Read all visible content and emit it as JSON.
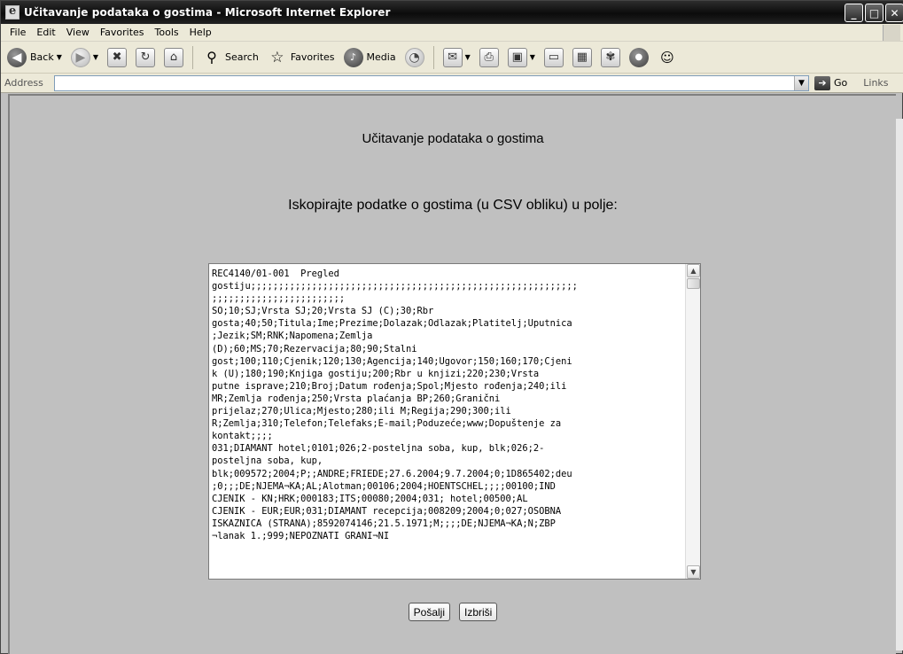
{
  "window": {
    "title": "Učitavanje podataka o gostima - Microsoft Internet Explorer",
    "minimize": "_",
    "maximize": "□",
    "close": "✕"
  },
  "menu": {
    "items": [
      {
        "label": "File"
      },
      {
        "label": "Edit"
      },
      {
        "label": "View"
      },
      {
        "label": "Favorites"
      },
      {
        "label": "Tools"
      },
      {
        "label": "Help"
      }
    ]
  },
  "toolbar": {
    "back_label": "Back",
    "search_label": "Search",
    "favorites_label": "Favorites",
    "media_label": "Media"
  },
  "address": {
    "label": "Address",
    "value": "",
    "go_label": "Go",
    "links_label": "Links"
  },
  "page": {
    "title": "Učitavanje podataka o gostima",
    "instruction": "Iskopirajte podatke o gostima (u CSV obliku) u polje:",
    "csv_text": "REC4140/01-001  Pregled\ngostiju;;;;;;;;;;;;;;;;;;;;;;;;;;;;;;;;;;;;;;;;;;;;;;;;;;;;;;;;;;;\n;;;;;;;;;;;;;;;;;;;;;;;;\nSO;10;SJ;Vrsta SJ;20;Vrsta SJ (C);30;Rbr\ngosta;40;50;Titula;Ime;Prezime;Dolazak;Odlazak;Platitelj;Uputnica\n;Jezik;SM;RNK;Napomena;Zemlja\n(D);60;MS;70;Rezervacija;80;90;Stalni\ngost;100;110;Cjenik;120;130;Agencija;140;Ugovor;150;160;170;Cjeni\nk (U);180;190;Knjiga gostiju;200;Rbr u knjizi;220;230;Vrsta\nputne isprave;210;Broj;Datum rođenja;Spol;Mjesto rođenja;240;ili\nMR;Zemlja rođenja;250;Vrsta plaćanja BP;260;Granični\nprijelaz;270;Ulica;Mjesto;280;ili M;Regija;290;300;ili\nR;Zemlja;310;Telefon;Telefaks;E-mail;Poduzeće;www;Dopuštenje za\nkontakt;;;;\n031;DIAMANT hotel;0101;026;2-posteljna soba, kup, blk;026;2-\nposteljna soba, kup,\nblk;009572;2004;P;;ANDRE;FRIEDE;27.6.2004;9.7.2004;0;1D865402;deu\n;0;;;DE;NJEMA¬KA;AL;Alotman;00106;2004;HOENTSCHEL;;;;00100;IND\nCJENIK - KN;HRK;000183;ITS;00080;2004;031; hotel;00500;AL\nCJENIK - EUR;EUR;031;DIAMANT recepcija;008209;2004;0;027;OSOBNA\nISKAZNICA (STRANA);8592074146;21.5.1971;M;;;;DE;NJEMA¬KA;N;ZBP\n¬lanak 1.;999;NEPOZNATI GRANI¬NI",
    "submit_label": "Pošalji",
    "reset_label": "Izbriši"
  }
}
